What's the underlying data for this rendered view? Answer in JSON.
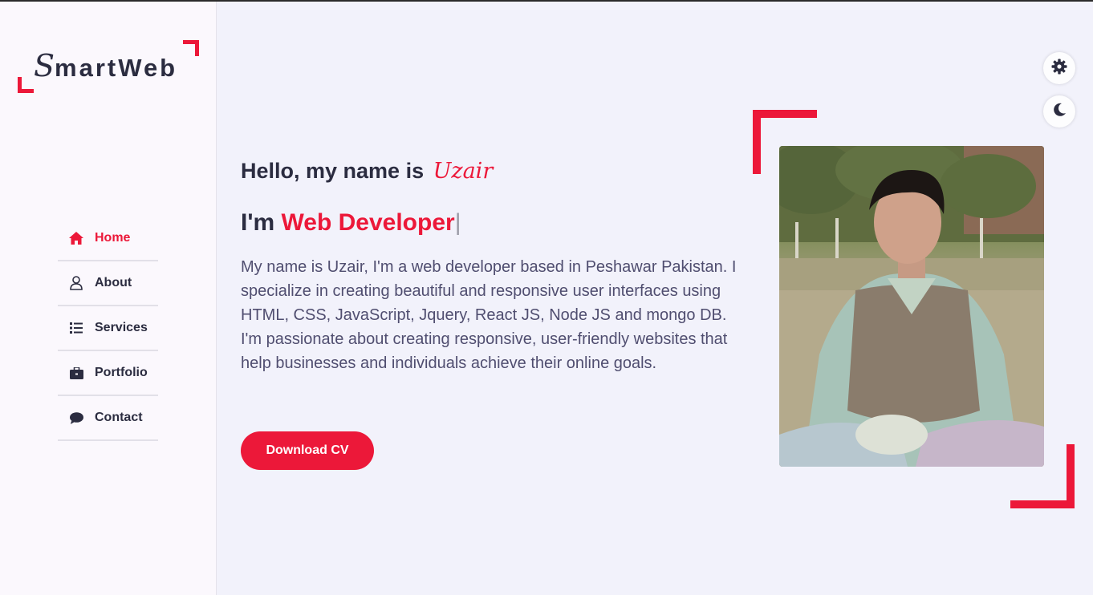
{
  "logo": {
    "first": "S",
    "rest": "martWeb"
  },
  "nav": {
    "items": [
      {
        "label": "Home",
        "icon": "home-icon",
        "active": true
      },
      {
        "label": "About",
        "icon": "user-icon"
      },
      {
        "label": "Services",
        "icon": "list-icon"
      },
      {
        "label": "Portfolio",
        "icon": "briefcase-icon"
      },
      {
        "label": "Contact",
        "icon": "chat-icon"
      }
    ]
  },
  "hero": {
    "greeting": "Hello, my name is",
    "name": "Uzair",
    "role_prefix": "I'm",
    "role": "Web Developer",
    "cursor": "|",
    "bio": "My name is Uzair, I'm a web developer based in Peshawar Pakistan. I specialize in creating beautiful and responsive user interfaces using HTML, CSS, JavaScript, Jquery, React JS, Node JS and mongo DB. I'm passionate about creating responsive, user-friendly websites that help businesses and individuals achieve their online goals.",
    "cv_label": "Download CV"
  },
  "colors": {
    "accent": "#ec1839",
    "text": "#2b2c40",
    "body": "#504e70"
  },
  "controls": {
    "settings_icon": "gear-icon",
    "theme_icon": "moon-icon"
  }
}
